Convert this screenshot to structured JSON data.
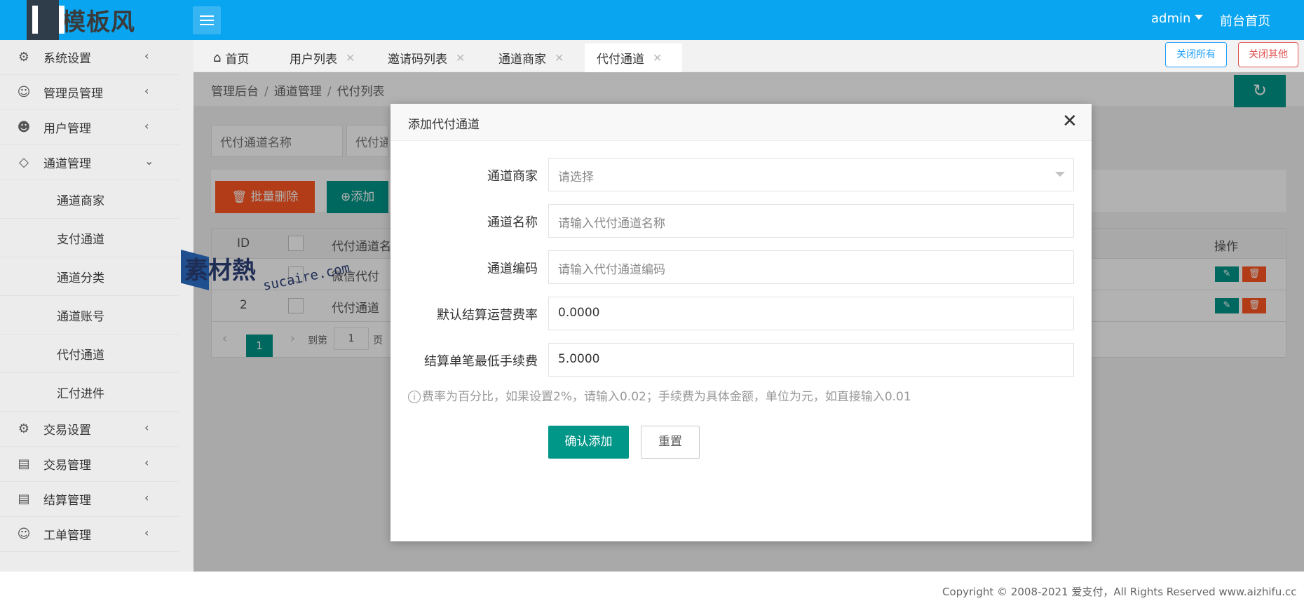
{
  "header": {
    "logo_text": "模板风",
    "user": "admin",
    "front_home": "前台首页"
  },
  "sidebar": {
    "items": [
      {
        "label": "系统设置",
        "icon": "gear-icon"
      },
      {
        "label": "管理员管理",
        "icon": "user-icon"
      },
      {
        "label": "用户管理",
        "icon": "users-icon"
      },
      {
        "label": "通道管理",
        "icon": "cube-icon"
      },
      {
        "label": "交易设置",
        "icon": "gear-icon"
      },
      {
        "label": "交易管理",
        "icon": "clipboard-icon"
      },
      {
        "label": "结算管理",
        "icon": "clipboard-icon"
      },
      {
        "label": "工单管理",
        "icon": "smile-icon"
      }
    ],
    "sub_items": [
      "通道商家",
      "支付通道",
      "通道分类",
      "通道账号",
      "代付通道",
      "汇付进件"
    ]
  },
  "tabs": [
    {
      "label": "首页"
    },
    {
      "label": "用户列表"
    },
    {
      "label": "邀请码列表"
    },
    {
      "label": "通道商家"
    },
    {
      "label": "代付通道"
    }
  ],
  "tab_actions": {
    "close_all": "关闭所有",
    "close_other": "关闭其他"
  },
  "breadcrumb": [
    "管理后台",
    "通道管理",
    "代付列表"
  ],
  "search": {
    "name_placeholder": "代付通道名称",
    "second_placeholder": "代付通道"
  },
  "toolbar": {
    "batch_delete": "批量删除",
    "add": "添加"
  },
  "table": {
    "headers": {
      "id": "ID",
      "name": "代付通道名",
      "ops": "操作"
    },
    "rows": [
      {
        "id": "",
        "name": "微信代付"
      },
      {
        "id": "2",
        "name": "代付通道"
      }
    ]
  },
  "pager": {
    "current": "1",
    "goto_label": "到第",
    "goto_value": "1",
    "page_suffix": "页"
  },
  "watermark": {
    "text": "素材熱",
    "url": "sucaire.com"
  },
  "modal": {
    "title": "添加代付通道",
    "fields": [
      {
        "label": "通道商家",
        "value": "",
        "placeholder": "请选择"
      },
      {
        "label": "通道名称",
        "value": "",
        "placeholder": "请输入代付通道名称"
      },
      {
        "label": "通道编码",
        "value": "",
        "placeholder": "请输入代付通道编码"
      },
      {
        "label": "默认结算运营费率",
        "value": "0.0000",
        "placeholder": ""
      },
      {
        "label": "结算单笔最低手续费",
        "value": "5.0000",
        "placeholder": ""
      }
    ],
    "hint": "费率为百分比，如果设置2%，请输入0.02；手续费为具体金额，单位为元，如直接输入0.01",
    "confirm": "确认添加",
    "reset": "重置"
  },
  "footer": {
    "copyright": "Copyright © 2008-2021 爱支付，All Rights Reserved www.aizhifu.cc"
  },
  "colors": {
    "header": "#0aa5f0",
    "primary": "#009688",
    "danger": "#ff5722"
  }
}
